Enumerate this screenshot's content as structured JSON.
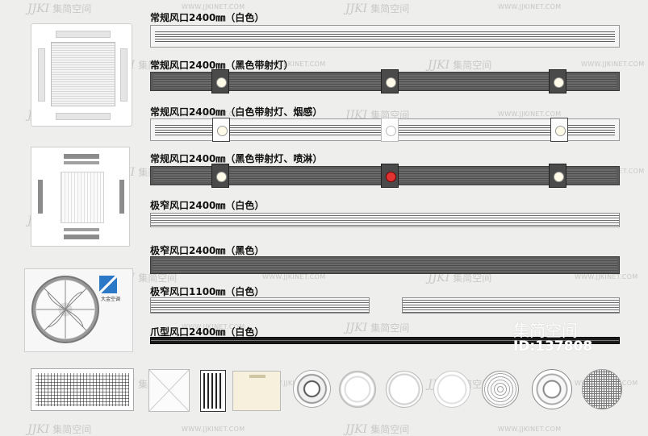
{
  "watermark": {
    "brand_logo": "JJKI",
    "brand_name": "集简空间",
    "url": "WWW.JJKINET.COM",
    "big_name": "集简空间",
    "big_id": "ID:137808"
  },
  "labels": [
    "常规风口2400㎜（白色）",
    "常规风口2400㎜（黑色带射灯）",
    "常规风口2400㎜（白色带射灯、烟感）",
    "常规风口2400㎜（黑色带射灯、喷淋）",
    "极窄风口2400㎜（白色）",
    "极窄风口2400㎜（黑色）",
    "极窄风口1100㎜（白色）",
    "爪型风口2400㎜（白色）"
  ],
  "outdoor_unit": {
    "brand_text": "大金空调"
  },
  "colors": {
    "background": "#eeeeec",
    "dark_vent": "#5a5a5a",
    "accent_red": "#e23333"
  }
}
